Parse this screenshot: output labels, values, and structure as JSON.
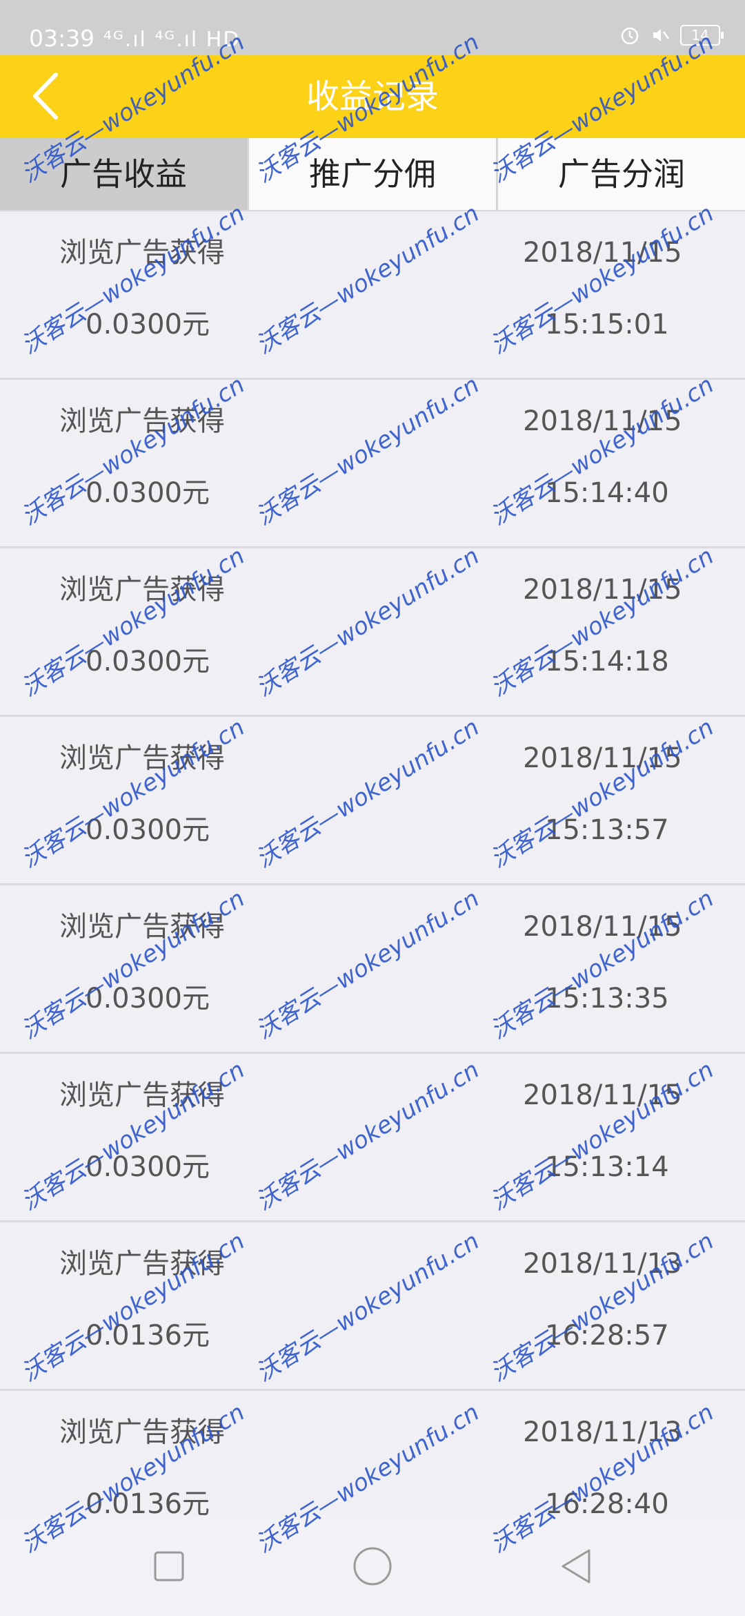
{
  "status_bar": {
    "time": "03:39",
    "signals": "⁴ᴳ.ıl ⁴ᴳ.ıl HD",
    "battery": "14"
  },
  "header": {
    "title": "收益记录"
  },
  "tabs": [
    {
      "label": "广告收益",
      "active": true
    },
    {
      "label": "推广分佣",
      "active": false
    },
    {
      "label": "广告分润",
      "active": false
    }
  ],
  "records": [
    {
      "title": "浏览广告获得",
      "amount": "0.0300元",
      "date": "2018/11/15",
      "time": "15:15:01"
    },
    {
      "title": "浏览广告获得",
      "amount": "0.0300元",
      "date": "2018/11/15",
      "time": "15:14:40"
    },
    {
      "title": "浏览广告获得",
      "amount": "0.0300元",
      "date": "2018/11/15",
      "time": "15:14:18"
    },
    {
      "title": "浏览广告获得",
      "amount": "0.0300元",
      "date": "2018/11/15",
      "time": "15:13:57"
    },
    {
      "title": "浏览广告获得",
      "amount": "0.0300元",
      "date": "2018/11/15",
      "time": "15:13:35"
    },
    {
      "title": "浏览广告获得",
      "amount": "0.0300元",
      "date": "2018/11/15",
      "time": "15:13:14"
    },
    {
      "title": "浏览广告获得",
      "amount": "0.0136元",
      "date": "2018/11/13",
      "time": "16:28:57"
    },
    {
      "title": "浏览广告获得",
      "amount": "0.0136元",
      "date": "2018/11/13",
      "time": "16:28:40"
    }
  ],
  "watermark": "沃客云—wokeyunfu.cn",
  "colors": {
    "header_bg": "#fcd218",
    "active_tab_bg": "#cccccc",
    "watermark": "#2c55c9"
  },
  "icons": {
    "back": "chevron-left-icon",
    "alarm": "alarm-icon",
    "nav_recent": "square-icon",
    "nav_home": "circle-icon",
    "nav_back": "triangle-back-icon"
  }
}
